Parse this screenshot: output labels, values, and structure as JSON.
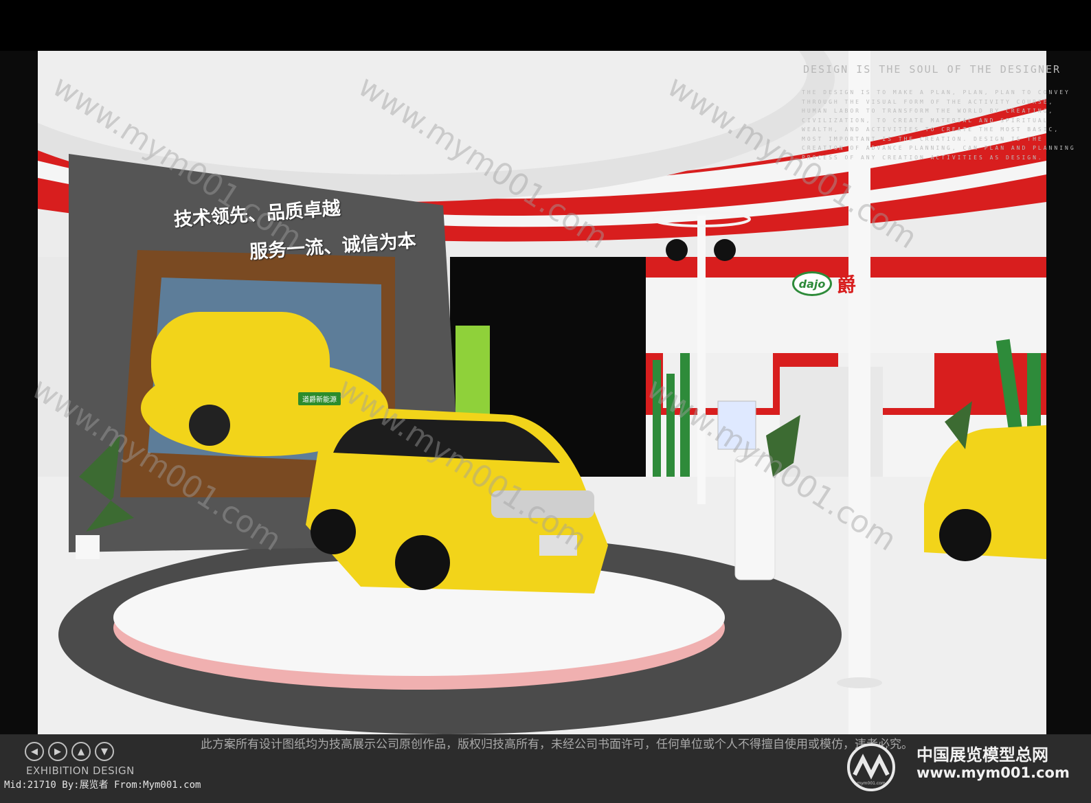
{
  "scene": {
    "header_text": "DESIGN IS THE SOUL OF THE DESIGNER",
    "body_text": "THE DESIGN IS TO MAKE A PLAN, PLAN, PLAN TO CONVEY THROUGH THE VISUAL FORM OF THE ACTIVITY COURSE, HUMAN LABOR TO TRANSFORM THE WORLD BY CREATING, CIVILIZATION, TO CREATE MATERIAL AND SPIRITUAL WEALTH, AND ACTIVITIES TO CREATE THE MOST BASIC, MOST IMPORTANT IS THE CREATION. DESIGN IS THE CREATION OF ADVANCE PLANNING, CAN PLAN AND PLANNING PROCESS OF ANY CREATION ACTIVITIES AS DESIGN.",
    "slogan_line1": "技术领先、品质卓越",
    "slogan_line2": "服务一流、诚信为本",
    "brand_badge": "dajo",
    "brand_char": "爵",
    "screen_tag": "道爵新能源",
    "watermark": "www.mym001.com"
  },
  "footer": {
    "nav_buttons": [
      "◀",
      "▶",
      "▲",
      "▼"
    ],
    "exhibition_label": "EXHIBITION DESIGN",
    "mid_label": "Mid:21710 By:展览者 From:Mym001.com",
    "copyright": "此方案所有设计图纸均为技高展示公司原创作品，版权归技高所有，未经公司书面许可，任何单位或个人不得擅自使用或模仿，违者必究。",
    "logo_cn": "中国展览模型总网",
    "logo_url": "www.mym001.com",
    "logo_mark_text": "mym001.com"
  },
  "colors": {
    "accent_red": "#d81e1e",
    "car_yellow": "#f2d41a",
    "floor": "#efefef",
    "dark_wall": "#555555",
    "green": "#2e8b3a"
  }
}
